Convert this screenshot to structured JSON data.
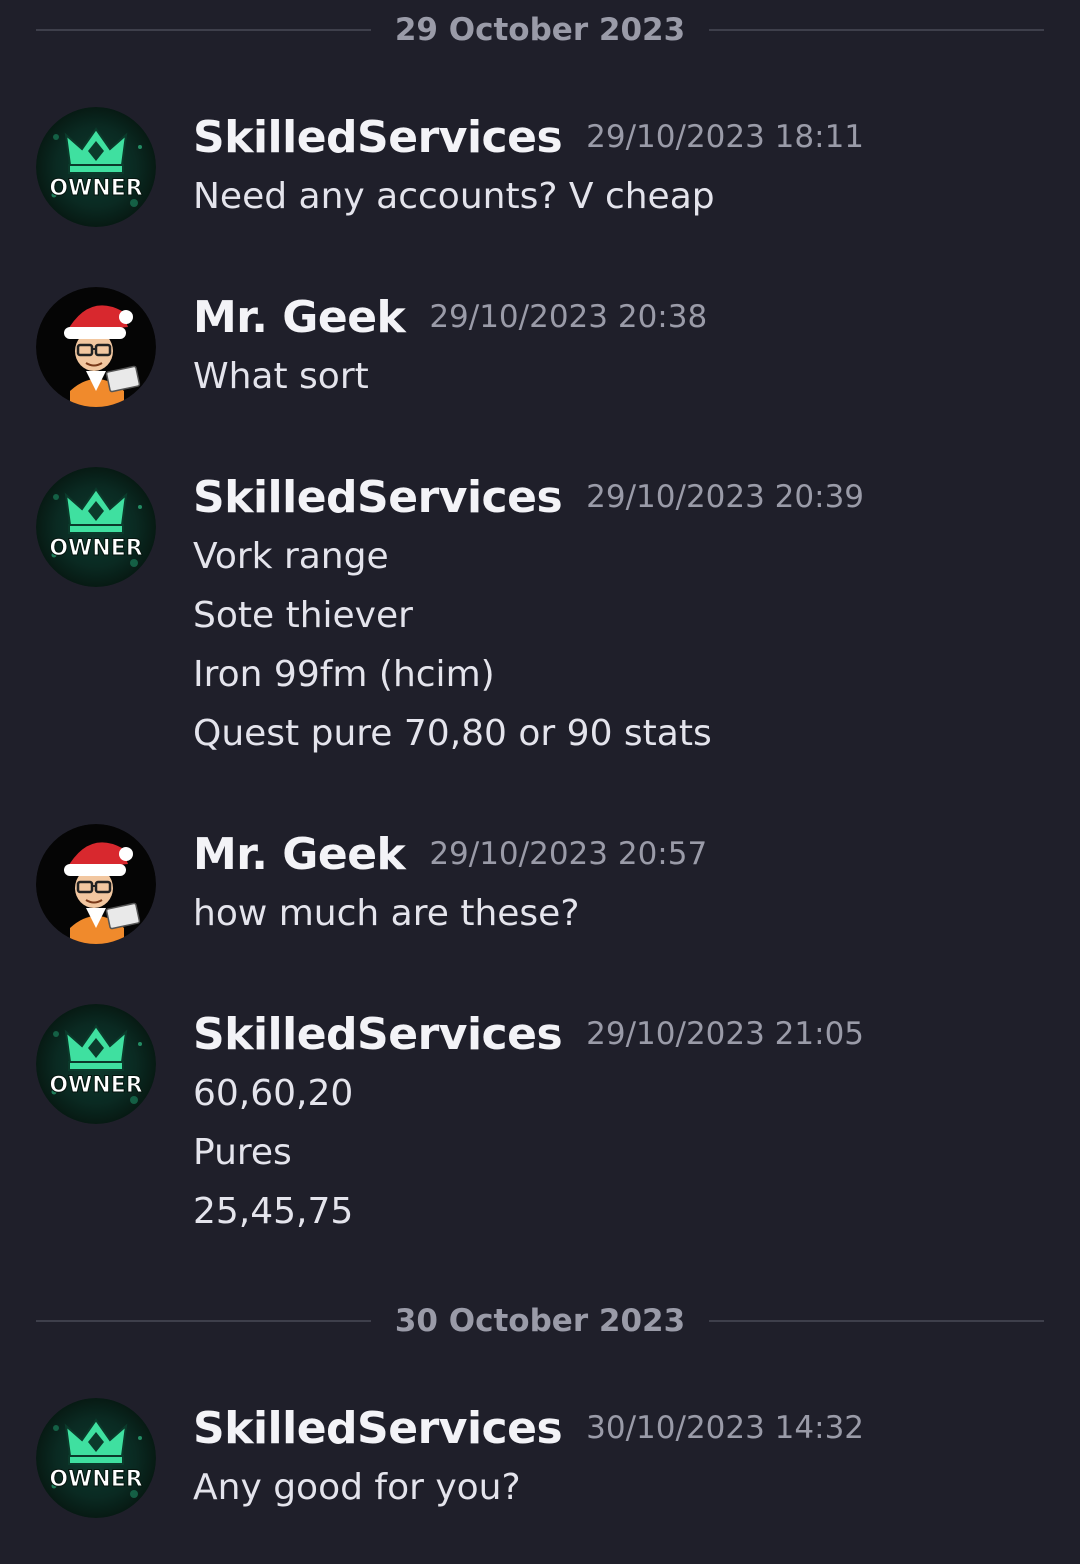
{
  "dividers": [
    {
      "label": "29 October 2023"
    },
    {
      "label": "30 October 2023"
    }
  ],
  "icons": {
    "owner_avatar": "owner-crown-avatar",
    "geek_avatar": "santa-hat-geek-avatar"
  },
  "colors": {
    "background": "#1f1f2a",
    "username": "#f3f3f7",
    "timestamp": "#9a9ba8",
    "body_text": "#e4e4ec",
    "owner_crown": "#3fe0a0"
  },
  "owner_badge": "OWNER",
  "messages": [
    {
      "author": "SkilledServices",
      "timestamp": "29/10/2023 18:11",
      "lines": [
        "Need any accounts? V cheap"
      ]
    },
    {
      "author": "Mr. Geek",
      "timestamp": "29/10/2023 20:38",
      "lines": [
        "What sort"
      ]
    },
    {
      "author": "SkilledServices",
      "timestamp": "29/10/2023 20:39",
      "lines": [
        "Vork range",
        "Sote thiever",
        "Iron 99fm (hcim)",
        "Quest pure 70,80 or 90 stats"
      ]
    },
    {
      "author": "Mr. Geek",
      "timestamp": "29/10/2023 20:57",
      "lines": [
        "how much are these?"
      ]
    },
    {
      "author": "SkilledServices",
      "timestamp": "29/10/2023 21:05",
      "lines": [
        "60,60,20",
        "Pures",
        "25,45,75"
      ]
    },
    {
      "author": "SkilledServices",
      "timestamp": "30/10/2023 14:32",
      "lines": [
        "Any good for you?"
      ]
    }
  ]
}
